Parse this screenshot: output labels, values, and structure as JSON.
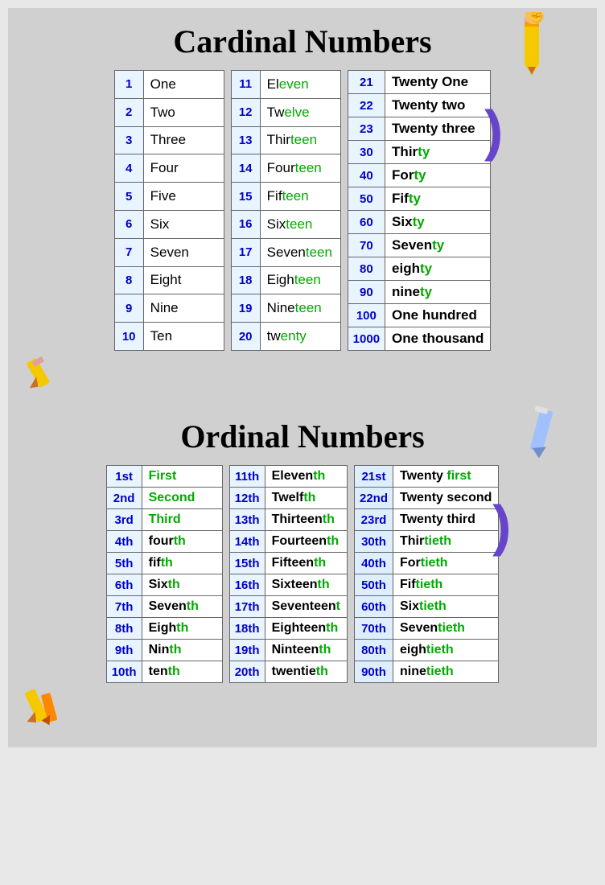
{
  "cardinal": {
    "title": "Cardinal Numbers",
    "col1": [
      {
        "num": "1",
        "word": "One"
      },
      {
        "num": "2",
        "word": "Two"
      },
      {
        "num": "3",
        "word": "Three"
      },
      {
        "num": "4",
        "word": "Four"
      },
      {
        "num": "5",
        "word": "Five"
      },
      {
        "num": "6",
        "word": "Six"
      },
      {
        "num": "7",
        "word": "Seven"
      },
      {
        "num": "8",
        "word": "Eight"
      },
      {
        "num": "9",
        "word": "Nine"
      },
      {
        "num": "10",
        "word": "Ten"
      }
    ],
    "col2": [
      {
        "num": "11",
        "word_black": "El",
        "word_green": "even"
      },
      {
        "num": "12",
        "word_black": "Tw",
        "word_green": "elve"
      },
      {
        "num": "13",
        "word_black": "Thir",
        "word_green": "teen"
      },
      {
        "num": "14",
        "word_black": "Four",
        "word_green": "teen"
      },
      {
        "num": "15",
        "word_black": "Fif",
        "word_green": "teen"
      },
      {
        "num": "16",
        "word_black": "Six",
        "word_green": "teen"
      },
      {
        "num": "17",
        "word_black": "Seven",
        "word_green": "teen"
      },
      {
        "num": "18",
        "word_black": "Eigh",
        "word_green": "teen"
      },
      {
        "num": "19",
        "word_black": "Nine",
        "word_green": "teen"
      },
      {
        "num": "20",
        "word_black": "tw",
        "word_green": "enty"
      }
    ],
    "col3": [
      {
        "num": "21",
        "word_black": "Twenty One"
      },
      {
        "num": "22",
        "word_black": "Twenty two"
      },
      {
        "num": "23",
        "word_black": "Twenty three"
      },
      {
        "num": "30",
        "word_black": "Thir",
        "word_green": "ty"
      },
      {
        "num": "40",
        "word_black": "For",
        "word_green": "ty"
      },
      {
        "num": "50",
        "word_black": "Fif",
        "word_green": "ty"
      },
      {
        "num": "60",
        "word_black": "Six",
        "word_green": "ty"
      },
      {
        "num": "70",
        "word_black": "Seven",
        "word_green": "ty"
      },
      {
        "num": "80",
        "word_black": "eigh",
        "word_green": "ty"
      },
      {
        "num": "90",
        "word_black": "nine",
        "word_green": "ty"
      },
      {
        "num": "100",
        "word_black": "One hundred"
      },
      {
        "num": "1000",
        "word_black": "One thousand"
      }
    ]
  },
  "ordinal": {
    "title": "Ordinal Numbers",
    "col1": [
      {
        "num": "1st",
        "word_green": "First"
      },
      {
        "num": "2nd",
        "word_green": "Second"
      },
      {
        "num": "3rd",
        "word_green": "Third"
      },
      {
        "num": "4th",
        "word_black": "four",
        "word_green": "th"
      },
      {
        "num": "5th",
        "word_black": "fif",
        "word_green": "th"
      },
      {
        "num": "6th",
        "word_black": "Six",
        "word_green": "th"
      },
      {
        "num": "7th",
        "word_black": "Seven",
        "word_green": "th"
      },
      {
        "num": "8th",
        "word_black": "Eigh",
        "word_green": "th"
      },
      {
        "num": "9th",
        "word_black": "Nin",
        "word_green": "th"
      },
      {
        "num": "10th",
        "word_black": "ten",
        "word_green": "th"
      }
    ],
    "col2": [
      {
        "num": "11th",
        "word_black": "Eleven",
        "word_green": "th"
      },
      {
        "num": "12th",
        "word_black": "Twelf",
        "word_green": "th"
      },
      {
        "num": "13th",
        "word_black": "Thirteen",
        "word_green": "th"
      },
      {
        "num": "14th",
        "word_black": "Fourteen",
        "word_green": "th"
      },
      {
        "num": "15th",
        "word_black": "Fifteen",
        "word_green": "th"
      },
      {
        "num": "16th",
        "word_black": "Sixteen",
        "word_green": "th"
      },
      {
        "num": "17th",
        "word_black": "Seventeen",
        "word_green": "t"
      },
      {
        "num": "18th",
        "word_black": "Eighteen",
        "word_green": "th"
      },
      {
        "num": "19th",
        "word_black": "Ninteen",
        "word_green": "th"
      },
      {
        "num": "20th",
        "word_black": "twentie",
        "word_green": "th"
      }
    ],
    "col3": [
      {
        "num": "21st",
        "word_black": "Twenty ",
        "word_green": "first"
      },
      {
        "num": "22nd",
        "word_black": "Twenty second"
      },
      {
        "num": "23rd",
        "word_black": "Twenty third"
      },
      {
        "num": "30th",
        "word_black": "Thir",
        "word_green": "tieth"
      },
      {
        "num": "40th",
        "word_black": "For",
        "word_green": "tieth"
      },
      {
        "num": "50th",
        "word_black": "Fif",
        "word_green": "tieth"
      },
      {
        "num": "60th",
        "word_black": "Six",
        "word_green": "tieth"
      },
      {
        "num": "70th",
        "word_black": "Seven",
        "word_green": "tieth"
      },
      {
        "num": "80th",
        "word_black": "eigh",
        "word_green": "tieth"
      },
      {
        "num": "90th",
        "word_black": "nine",
        "word_green": "tieth"
      }
    ]
  }
}
